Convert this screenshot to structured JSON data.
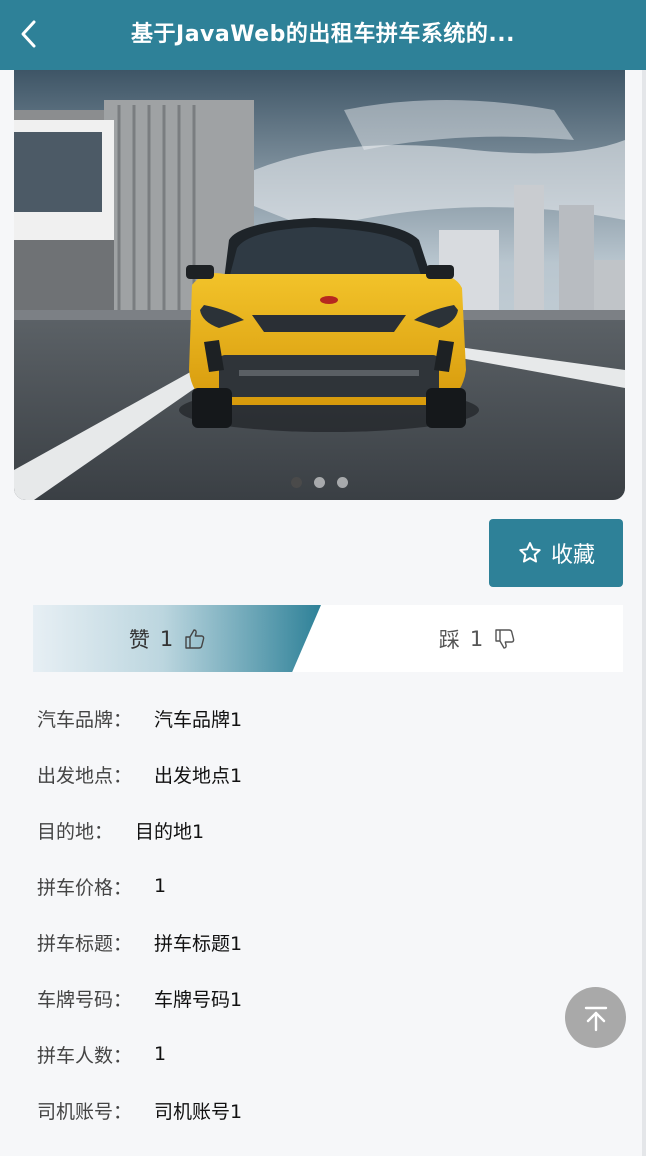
{
  "header": {
    "title": "基于JavaWeb的出租车拼车系统的...",
    "back_icon": "chevron-left-icon",
    "background": "#2e8198"
  },
  "banner": {
    "slides": [
      "slide-1",
      "slide-2",
      "slide-3"
    ],
    "active_index": 0
  },
  "favorite": {
    "label": "收藏",
    "icon": "star-outline-icon"
  },
  "vote": {
    "like_label": "赞",
    "like_count": "1",
    "like_icon": "thumbs-up-icon",
    "dislike_label": "踩",
    "dislike_count": "1",
    "dislike_icon": "thumbs-down-icon"
  },
  "details": [
    {
      "label": "汽车品牌：",
      "value": "汽车品牌1"
    },
    {
      "label": "出发地点：",
      "value": "出发地点1"
    },
    {
      "label": "目的地：",
      "value": "目的地1"
    },
    {
      "label": "拼车价格：",
      "value": "1"
    },
    {
      "label": "拼车标题：",
      "value": "拼车标题1"
    },
    {
      "label": "车牌号码：",
      "value": "车牌号码1"
    },
    {
      "label": "拼车人数：",
      "value": "1"
    },
    {
      "label": "司机账号：",
      "value": "司机账号1"
    }
  ],
  "back_to_top": {
    "icon": "arrow-up-to-top-icon"
  },
  "colors": {
    "accent": "#2e8198",
    "top_button": "#a9a9a9"
  }
}
